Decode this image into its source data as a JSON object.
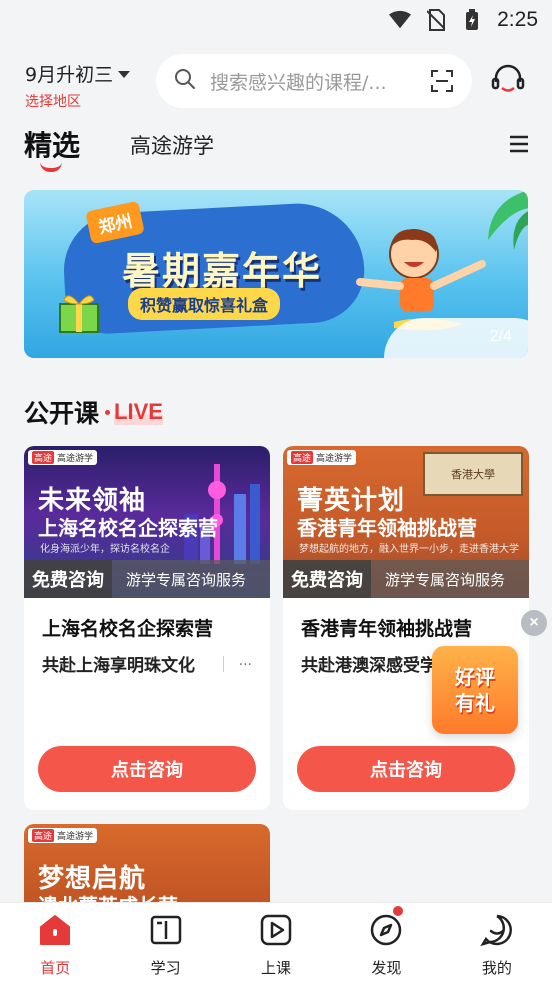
{
  "status_bar": {
    "time": "2:25"
  },
  "header": {
    "grade": "9月升初三",
    "region_select": "选择地区",
    "search_placeholder": "搜索感兴趣的课程/..."
  },
  "tabs": [
    {
      "label": "精选",
      "active": true
    },
    {
      "label": "高途游学",
      "active": false
    }
  ],
  "banner": {
    "city": "郑州",
    "headline": "暑期嘉年华",
    "subline": "积赞赢取惊喜礼盒",
    "pager": "2/4"
  },
  "section": {
    "title": "公开课",
    "live": "LIVE"
  },
  "cards": [
    {
      "cover_badge": "高途",
      "cover_brand": "高途游学",
      "cover_title1": "未来领袖",
      "cover_title2": "上海名校名企探索营",
      "cover_small": "化身海派少年，探访名校名企",
      "free_label": "免费咨询",
      "service_label": "游学专属咨询服务",
      "name": "上海名校名企探索营",
      "desc": "共赴上海享明珠文化",
      "more": "...",
      "cta": "点击咨询"
    },
    {
      "cover_badge": "高途",
      "cover_brand": "高途游学",
      "cover_title1": "菁英计划",
      "cover_title2": "香港青年领袖挑战营",
      "cover_small": "梦想起航的地方，融入世界一小步，走进香港大学",
      "cover_sign": "香港大學",
      "free_label": "免费咨询",
      "service_label": "游学专属咨询服务",
      "name": "香港青年领袖挑战营",
      "desc": "共赴港澳深感受学",
      "cta": "点击咨询"
    },
    {
      "cover_badge": "高途",
      "cover_brand": "高途游学",
      "cover_title1": "梦想启航",
      "cover_title2": "遗北菁英成长营"
    }
  ],
  "review_float": {
    "line1": "好评",
    "line2": "有礼",
    "close": "×"
  },
  "bottom_nav": [
    {
      "label": "首页",
      "icon": "home-icon",
      "active": true
    },
    {
      "label": "学习",
      "icon": "book-icon",
      "active": false
    },
    {
      "label": "上课",
      "icon": "play-icon",
      "active": false
    },
    {
      "label": "发现",
      "icon": "compass-icon",
      "active": false,
      "dot": true
    },
    {
      "label": "我的",
      "icon": "profile-icon",
      "active": false
    }
  ],
  "colors": {
    "accent": "#e5393a",
    "cta": "#f4564a",
    "background": "#f3f4f6"
  }
}
